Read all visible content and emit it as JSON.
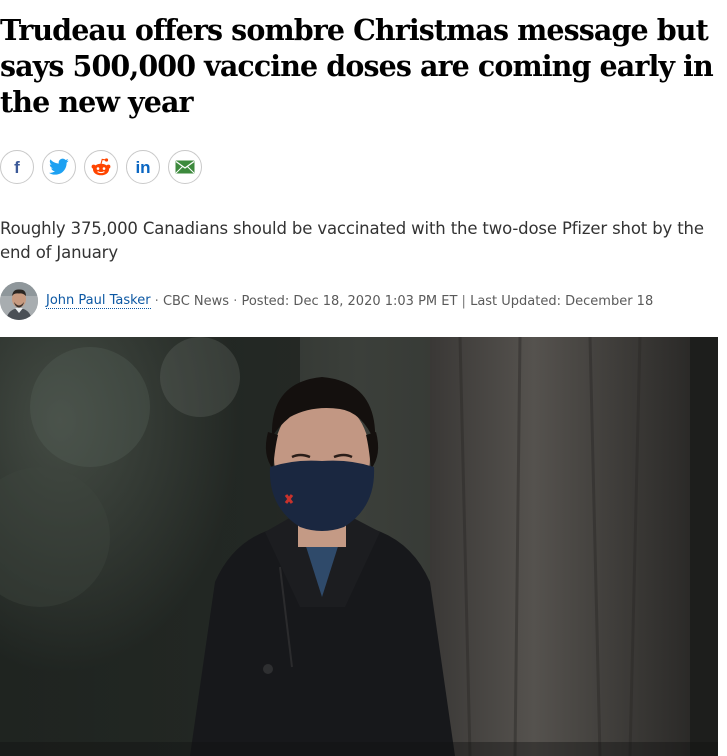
{
  "article": {
    "headline": "Trudeau offers sombre Christmas message but says 500,000 vaccine doses are coming early in the new year",
    "deck": "Roughly 375,000 Canadians should be vaccinated with the two-dose Pfizer shot by the end of January"
  },
  "share": {
    "buttons": [
      {
        "network": "facebook",
        "icon": "facebook-icon",
        "color": "#3b5998"
      },
      {
        "network": "twitter",
        "icon": "twitter-icon",
        "color": "#1da1f2"
      },
      {
        "network": "reddit",
        "icon": "reddit-icon",
        "color": "#ff4500"
      },
      {
        "network": "linkedin",
        "icon": "linkedin-icon",
        "color": "#0a66c2"
      },
      {
        "network": "email",
        "icon": "email-icon",
        "color": "#3d8a3d"
      }
    ]
  },
  "byline": {
    "author": "John Paul Tasker",
    "source": "CBC News",
    "posted_label": "Posted: Dec 18, 2020 1:03 PM ET",
    "updated_label": "Last Updated: December 18"
  },
  "colors": {
    "link": "#0b57a3",
    "headline": "#000000",
    "meta": "#5a5a5a"
  }
}
